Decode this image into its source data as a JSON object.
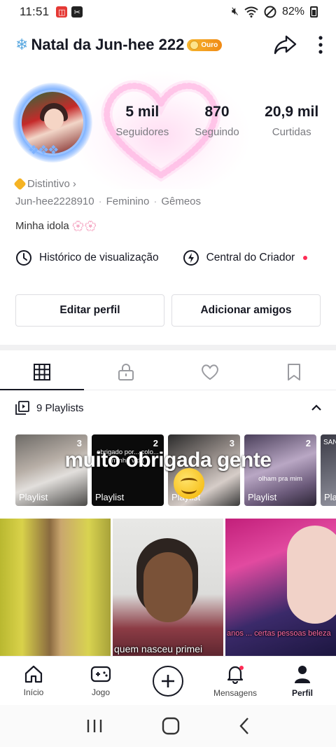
{
  "status_bar": {
    "time": "11:51",
    "battery": "82%"
  },
  "header": {
    "display_name": "Natal da Jun-hee 222",
    "badge_label": "Ouro",
    "prefix_icon": "snowflake-icon"
  },
  "stats": [
    {
      "value": "5 mil",
      "label": "Seguidores"
    },
    {
      "value": "870",
      "label": "Seguindo"
    },
    {
      "value": "20,9 mil",
      "label": "Curtidas"
    }
  ],
  "bio": {
    "badge_label": "Distintivo",
    "username": "Jun-hee2228910",
    "gender": "Feminino",
    "sign": "Gêmeos",
    "description": "Minha idola"
  },
  "links": {
    "history": "Histórico de visualização",
    "creator": "Central do Criador"
  },
  "buttons": {
    "edit": "Editar perfil",
    "add_friends": "Adicionar amigos"
  },
  "playlists_header": "9 Playlists",
  "playlists": [
    {
      "count": "3",
      "label": "Playlist",
      "text": ""
    },
    {
      "count": "2",
      "label": "Playlist",
      "text": "obrigado por... colo... minha vida"
    },
    {
      "count": "3",
      "label": "Playlist",
      "text": ""
    },
    {
      "count": "2",
      "label": "Playlist",
      "text": "olham pra mim"
    },
    {
      "count": "",
      "label": "Pla",
      "text": "SAN"
    }
  ],
  "overlay_text": "muito obrigada gente",
  "videos": [
    {
      "caption": ""
    },
    {
      "caption": "quem nasceu primei"
    },
    {
      "caption": "anos ... certas pessoas beleza"
    }
  ],
  "bottom_nav": [
    {
      "label": "Início",
      "icon": "home-icon"
    },
    {
      "label": "Jogo",
      "icon": "gamepad-icon"
    },
    {
      "label": "",
      "icon": "plus-icon"
    },
    {
      "label": "Mensagens",
      "icon": "bell-icon"
    },
    {
      "label": "Perfil",
      "icon": "person-icon"
    }
  ],
  "colors": {
    "accent_red": "#fe2c55",
    "gold": "#f5b323",
    "text": "#161823",
    "muted": "#7a7b80"
  }
}
